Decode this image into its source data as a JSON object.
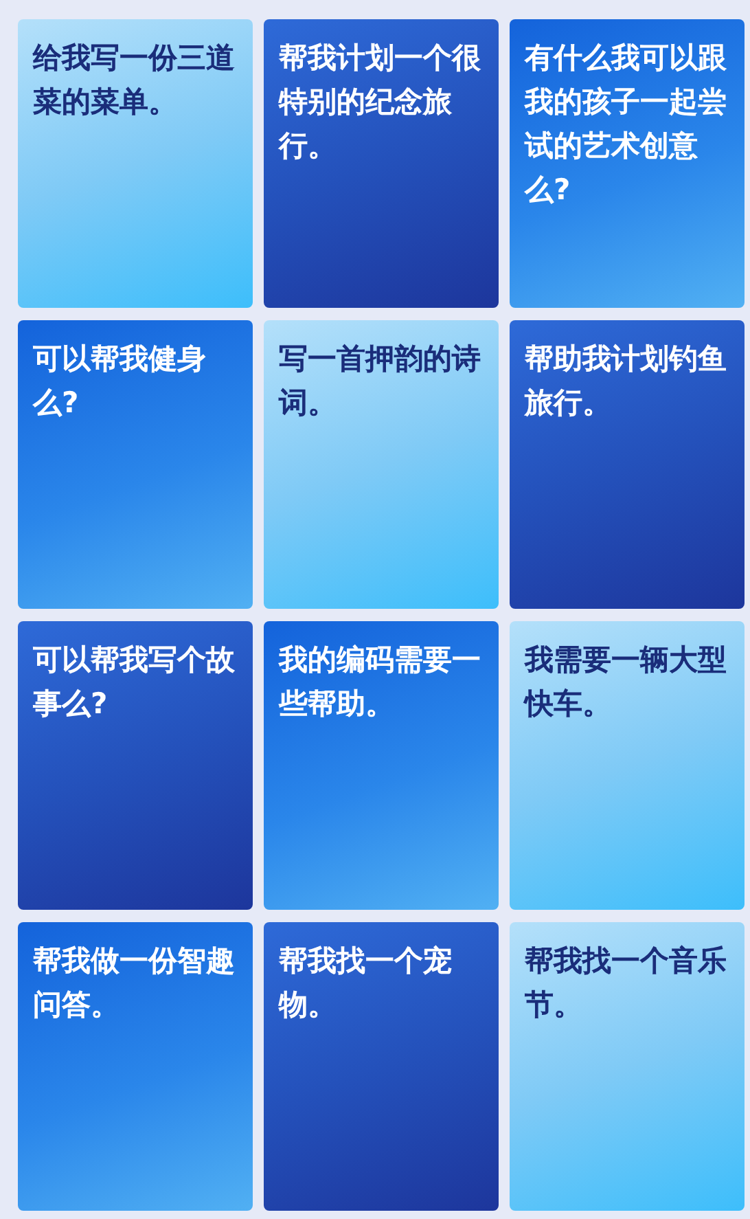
{
  "prompt_cards": [
    {
      "text": "给我写一份三道菜的菜单。",
      "kind": "light"
    },
    {
      "text": "帮我计划一个很特别的纪念旅行。",
      "kind": "dark"
    },
    {
      "text": "有什么我可以跟我的孩子一起尝试的艺术创意么?",
      "kind": "medium"
    },
    {
      "text": "可以帮我健身么?",
      "kind": "medium"
    },
    {
      "text": "写一首押韵的诗词。",
      "kind": "light"
    },
    {
      "text": "帮助我计划钓鱼旅行。",
      "kind": "dark"
    },
    {
      "text": "可以帮我写个故事么?",
      "kind": "dark"
    },
    {
      "text": "我的编码需要一些帮助。",
      "kind": "medium"
    },
    {
      "text": "我需要一辆大型快车。",
      "kind": "light"
    },
    {
      "text": "帮我做一份智趣问答。",
      "kind": "medium"
    },
    {
      "text": "帮我找一个宠物。",
      "kind": "dark"
    },
    {
      "text": "帮我找一个音乐节。",
      "kind": "light"
    }
  ]
}
